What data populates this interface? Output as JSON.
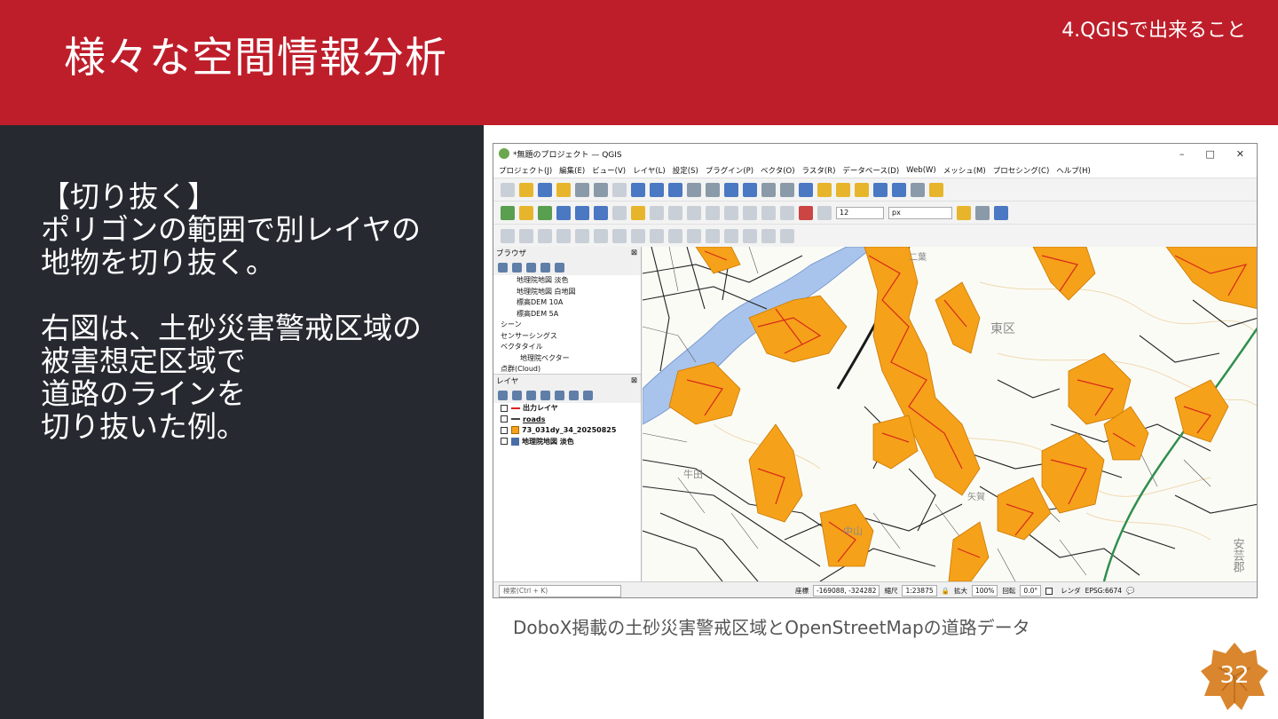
{
  "slide": {
    "title": "様々な空間情報分析",
    "section": "4.QGISで出来ること",
    "body_lines": [
      "【切り抜く】",
      "ポリゴンの範囲で別レイヤの",
      "地物を切り抜く。",
      "",
      "右図は、土砂災害警戒区域の",
      "被害想定区域で",
      "道路のラインを",
      "切り抜いた例。"
    ],
    "caption": "DoboX掲載の土砂災害警戒区域とOpenStreetMapの道路データ",
    "page_number": "32"
  },
  "qgis": {
    "window_title": "*無題のプロジェクト — QGIS",
    "window_controls": [
      "–",
      "□",
      "✕"
    ],
    "menu": [
      "プロジェクト(J)",
      "編集(E)",
      "ビュー(V)",
      "レイヤ(L)",
      "設定(S)",
      "プラグイン(P)",
      "ベクタ(O)",
      "ラスタ(R)",
      "データベース(D)",
      "Web(W)",
      "メッシュ(M)",
      "プロセシング(C)",
      "ヘルプ(H)"
    ],
    "toolbar": {
      "size_value": "12",
      "unit_value": "px"
    },
    "browser": {
      "title": "ブラウザ",
      "items": [
        "地理院地図 淡色",
        "地理院地図 白地図",
        "標高DEM 10A",
        "標高DEM 5A",
        "シーン",
        "センサーシングス",
        "ベクタタイル",
        "地理院ベクター",
        "点群(Cloud)"
      ]
    },
    "layers": {
      "title": "レイヤ",
      "items": [
        "出力レイヤ",
        "roads",
        "73_031dy_34_20250825",
        "地理院地図 淡色"
      ]
    },
    "map_labels": [
      "東区",
      "安芸郡",
      "中山",
      "牛田",
      "二葉",
      "矢賀"
    ],
    "status": {
      "search_placeholder": "検索(Ctrl + K)",
      "coord_label": "座標",
      "coord_value": "-169088, -324282",
      "scale_label": "縮尺",
      "scale_value": "1:23875",
      "magnifier_label": "拡大",
      "magnifier_value": "100%",
      "rotation_label": "回転",
      "rotation_value": "0.0°",
      "render_label": "レンダ",
      "crs": "EPSG:6674"
    }
  },
  "colors": {
    "header": "#be1e2a",
    "panel": "#262930",
    "hazard_fill": "#f6a11a",
    "road_clip": "#d62a1a"
  }
}
